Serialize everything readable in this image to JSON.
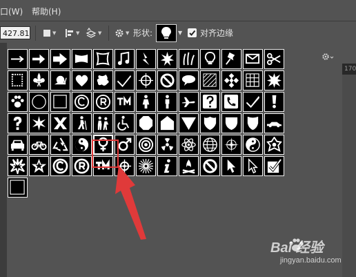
{
  "menubar": {
    "items": [
      "口(W)",
      "帮助(H)"
    ]
  },
  "options_bar": {
    "number_value": "427.81 |",
    "shape_label": "形状:",
    "align_edges_label": "对齐边缘",
    "align_edges_checked": true
  },
  "ruler": {
    "value": "170"
  },
  "shape_picker": {
    "selected_index": 56,
    "highlighted_index": 69,
    "shapes": [
      "arrow-thin-icon",
      "arrow-icon",
      "arrow-bold-icon",
      "banner-icon",
      "frame-icon",
      "music-note-icon",
      "lightning-icon",
      "starburst-icon",
      "grass-icon",
      "lightbulb-icon",
      "pushpin-icon",
      "envelope-icon",
      "scissors-icon",
      "stamp-frame-icon",
      "fleur-de-lis-icon",
      "snail-icon",
      "heart-icon",
      "splat-icon",
      "checkmark-icon",
      "crosshair-icon",
      "no-symbol-icon",
      "speech-bubble-icon",
      "hatched-square-icon",
      "checkerboard-icon",
      "grid-icon",
      "burst-icon",
      "paw-icon",
      "circle-outline-icon",
      "square-outline-icon",
      "copyright-icon",
      "registered-icon",
      "trademark-icon",
      "woman-icon",
      "man-icon",
      "airplane-icon",
      "question-icon",
      "phone-icon",
      "check-box-icon",
      "exclamation-icon",
      "question-mark-icon",
      "star-burst-icon",
      "x-mark-icon",
      "hiker-icon",
      "school-children-icon",
      "wheelchair-icon",
      "octagon-icon",
      "pentagon-house-icon",
      "triangle-down-icon",
      "shield-badge-icon",
      "shield-icon",
      "crest-icon",
      "car-side-icon",
      "car-front-icon",
      "bicycle-icon",
      "recycle-icon",
      "yin-yang-icon",
      "female-symbol-icon",
      "male-symbol-icon",
      "target-icon",
      "radiation-icon",
      "atom-icon",
      "globe-icon",
      "compass-icon",
      "yin-yang-outline-icon",
      "ornament-icon",
      "explosion-icon",
      "star-icon",
      "copyright-bold-icon",
      "registered-bold-icon",
      "trademark-bold-icon",
      "target-cross-icon",
      "sunburst-icon",
      "info-icon",
      "campfire-icon",
      "prohibited-icon",
      "cursor-arrow-icon",
      "cursor-outline-icon",
      "checkbox-checked-icon",
      "square-white-icon"
    ]
  },
  "watermark": {
    "brand": "Bai 经验",
    "url": "jingyan.baidu.com"
  },
  "colors": {
    "background": "#535353",
    "annotation": "#e03a3a",
    "cell_fill": "#000000",
    "icon_fill": "#ffffff"
  }
}
